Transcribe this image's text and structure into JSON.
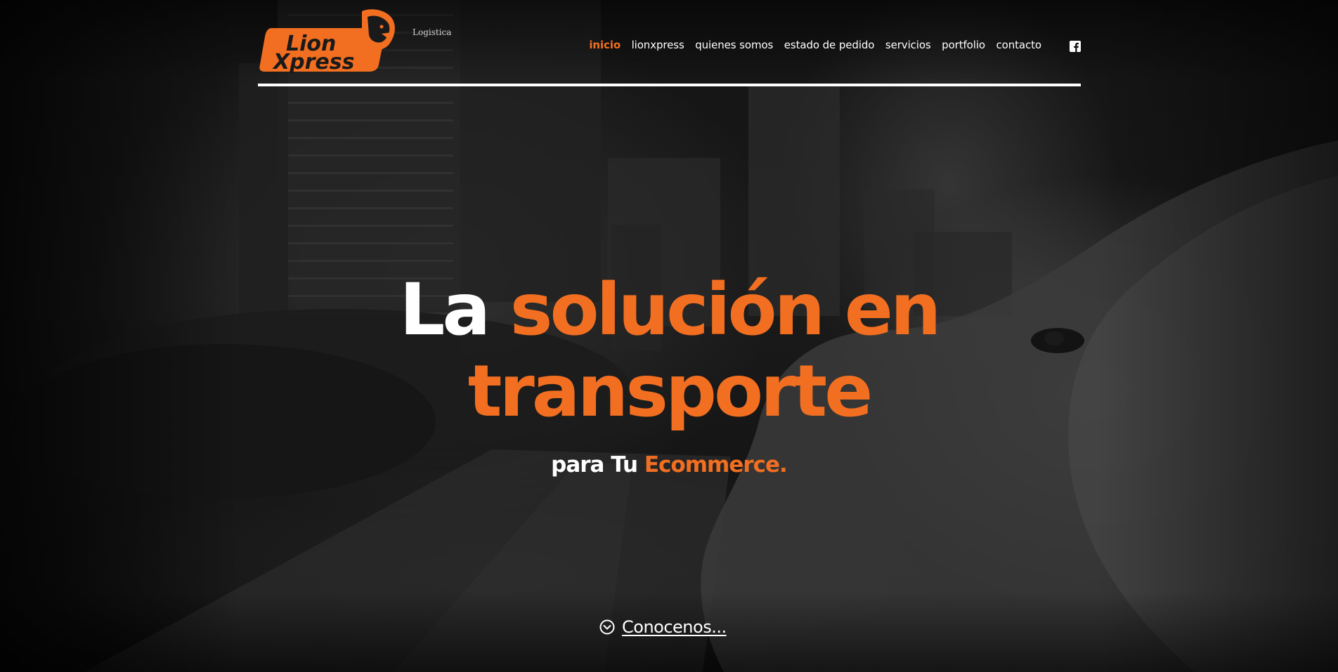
{
  "brand": {
    "logo_word_top": "Lion",
    "logo_word_bottom": "Xpress",
    "tagline": "Logistica",
    "accent_color": "#f26f21"
  },
  "nav": {
    "items": [
      {
        "label": "inicio",
        "active": true
      },
      {
        "label": "lionxpress",
        "active": false
      },
      {
        "label": "quienes somos",
        "active": false
      },
      {
        "label": "estado de pedido",
        "active": false
      },
      {
        "label": "servicios",
        "active": false
      },
      {
        "label": "portfolio",
        "active": false
      },
      {
        "label": "contacto",
        "active": false
      }
    ],
    "social_icon": "facebook-icon"
  },
  "hero": {
    "headline_white": "La",
    "headline_orange_1": "solución en",
    "headline_orange_2": "transporte",
    "sub_white": "para Tu",
    "sub_orange": "Ecommerce",
    "sub_period": "."
  },
  "cta": {
    "icon": "chevron-down-circle-icon",
    "label": "Conocenos..."
  }
}
